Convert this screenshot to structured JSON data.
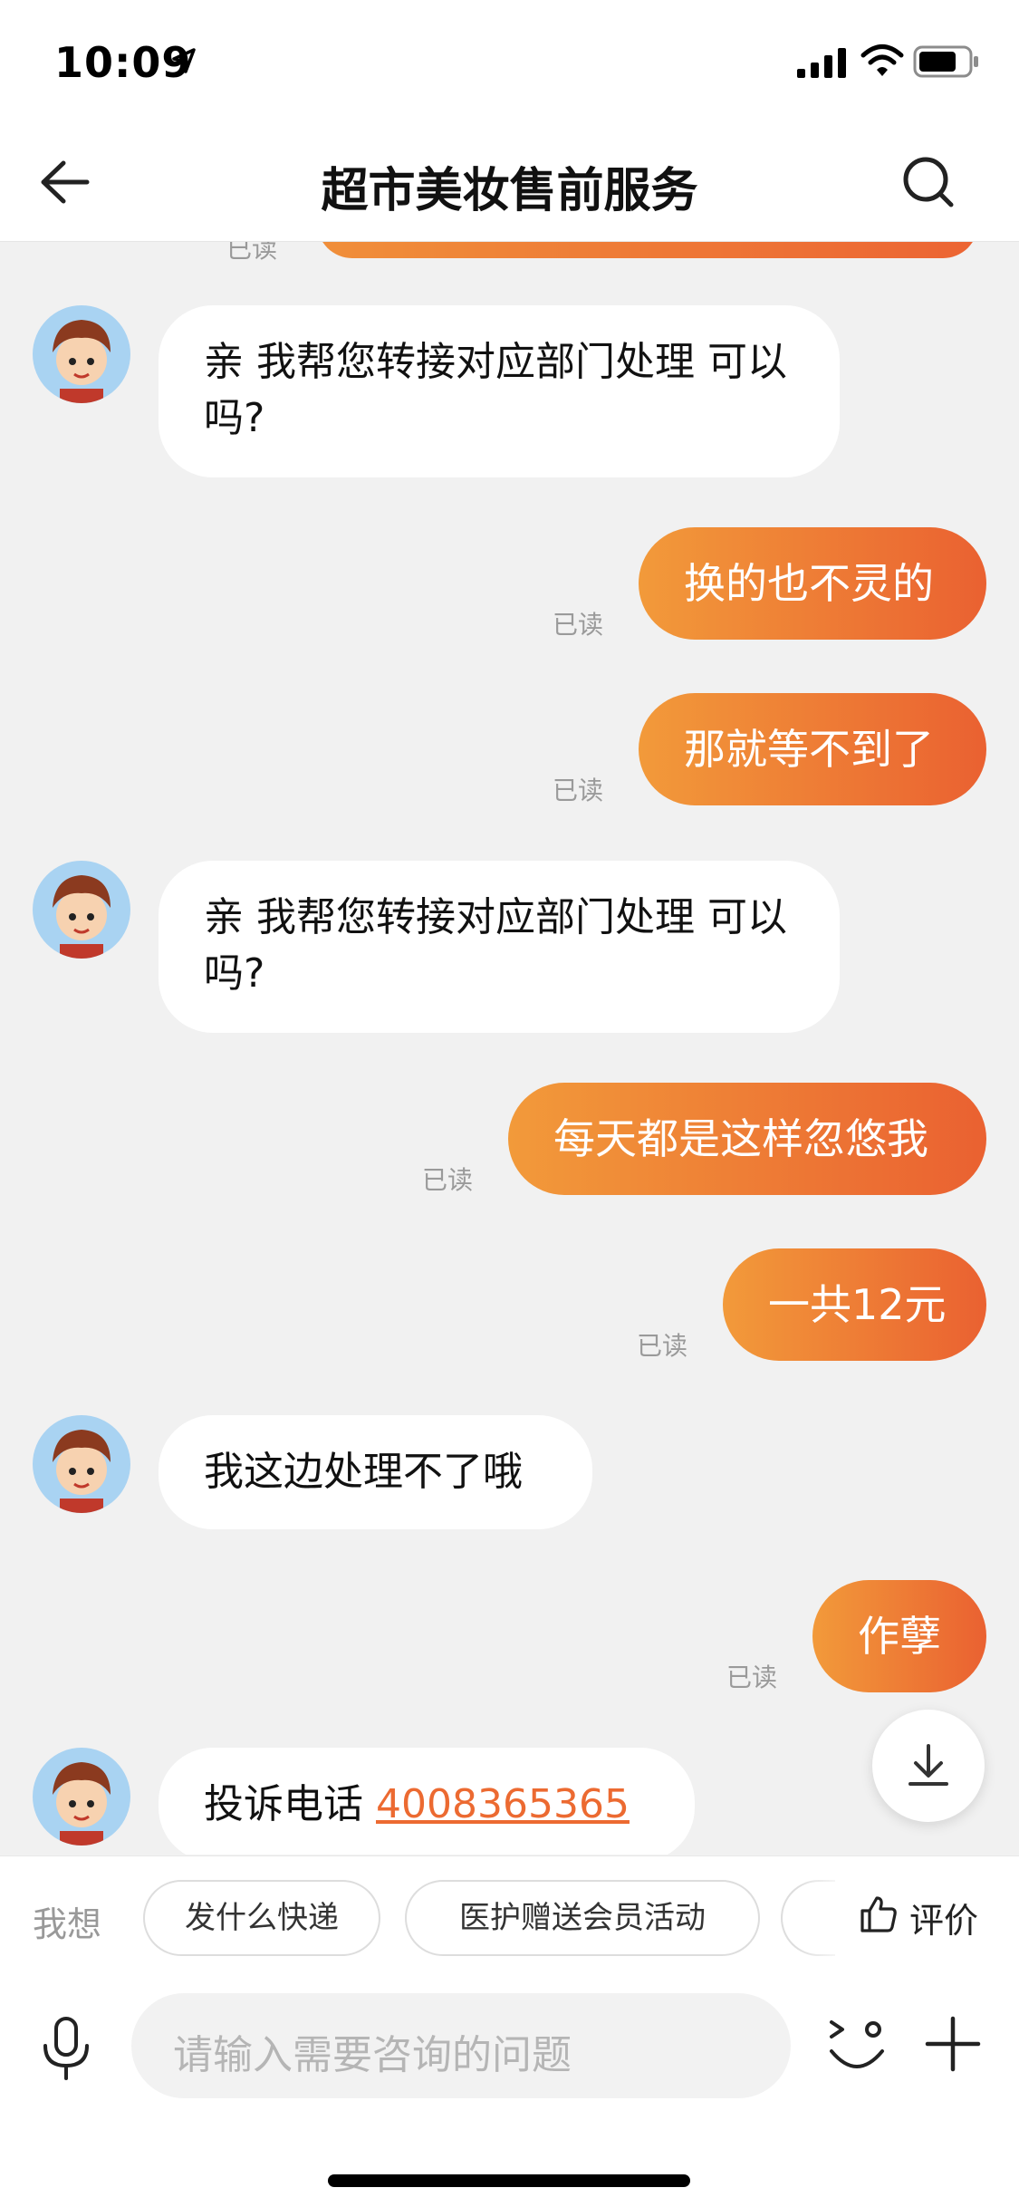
{
  "status_bar": {
    "time": "10:09"
  },
  "nav": {
    "title": "超市美妆售前服务"
  },
  "chat": {
    "read_label": "已读",
    "messages": [
      {
        "side": "in",
        "text": "亲 我帮您转接对应部门处理 可以吗?"
      },
      {
        "side": "out",
        "text": "换的也不灵的"
      },
      {
        "side": "out",
        "text": "那就等不到了"
      },
      {
        "side": "in",
        "text": "亲 我帮您转接对应部门处理 可以吗?"
      },
      {
        "side": "out",
        "text": "每天都是这样忽悠我"
      },
      {
        "side": "out",
        "text": "一共12元"
      },
      {
        "side": "in",
        "text": "我这边处理不了哦"
      },
      {
        "side": "out",
        "text": "作孽"
      },
      {
        "side": "in",
        "text_prefix": "投诉电话 ",
        "phone": "4008365365"
      }
    ]
  },
  "quick_bar": {
    "label": "我想",
    "chips": [
      "发什么快递",
      "医护赠送会员活动"
    ],
    "rate_label": "评价"
  },
  "input": {
    "placeholder": "请输入需要咨询的问题"
  },
  "colors": {
    "accent_start": "#f29a3a",
    "accent_end": "#ea6131",
    "link": "#ec6a31"
  }
}
